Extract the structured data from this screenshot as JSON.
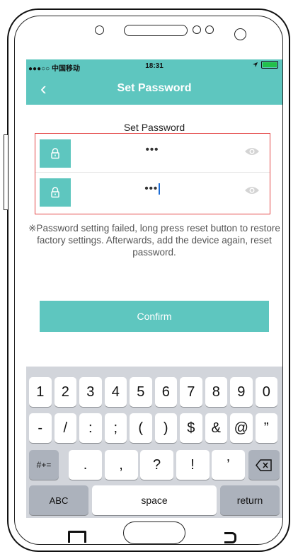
{
  "status_bar": {
    "carrier": "●●●○○ 中国移动",
    "time": "18:31"
  },
  "header": {
    "back_icon": "‹",
    "title": "Set Password"
  },
  "form": {
    "section_title": "Set Password",
    "password": {
      "value": "•••"
    },
    "confirm_password": {
      "value": "•••"
    },
    "hint": "※Password setting failed, long press reset button to restore factory settings. Afterwards, add the device again, reset password.",
    "confirm_label": "Confirm"
  },
  "keyboard": {
    "row1": [
      "1",
      "2",
      "3",
      "4",
      "5",
      "6",
      "7",
      "8",
      "9",
      "0"
    ],
    "row2": [
      "-",
      "/",
      ":",
      ";",
      "(",
      ")",
      "$",
      "&",
      "@",
      "”"
    ],
    "symbols_toggle": "#+=",
    "row3": [
      ".",
      ",",
      "?",
      "!",
      "’"
    ],
    "abc_label": "ABC",
    "space_label": "space",
    "return_label": "return"
  },
  "colors": {
    "accent": "#5ec6bf",
    "error_border": "#e34545",
    "keyboard_bg": "#d2d5db"
  }
}
